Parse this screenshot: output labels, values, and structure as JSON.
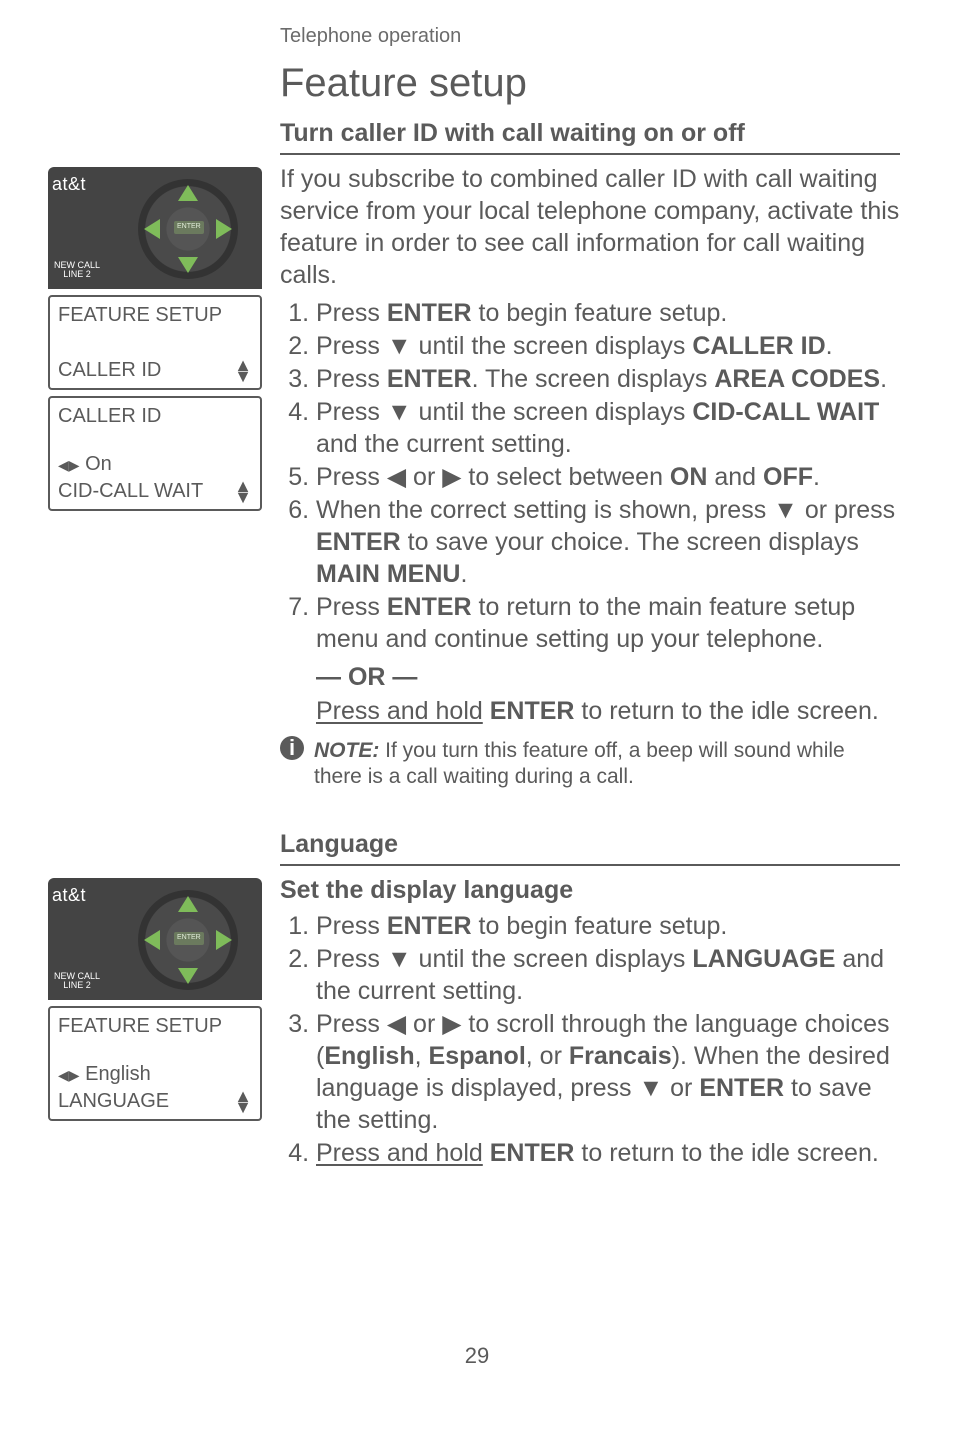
{
  "category": "Telephone operation",
  "title": "Feature setup",
  "page_number": "29",
  "device": {
    "logo": "at&t",
    "line_btn_top": "NEW CALL",
    "line_btn_bottom": "LINE 2",
    "center_btn": "ENTER"
  },
  "g": {
    "down": "▼",
    "up": "▲",
    "left": "◀",
    "right": "▶",
    "lr": "◀▶"
  },
  "sec1": {
    "heading": "Turn caller ID with call waiting on or off",
    "intro": "If you subscribe to combined caller ID with call waiting service from your local telephone company, activate this feature in order to see call information for call waiting calls.",
    "s1a": "Press ",
    "s1b": "ENTER",
    "s1c": " to begin feature setup.",
    "s2a": "Press ",
    "s2b": " until the screen displays ",
    "s2c": "CALLER ID",
    "s2d": ".",
    "s3a": "Press ",
    "s3b": "ENTER",
    "s3c": ". The screen displays ",
    "s3d": "AREA CODES",
    "s3e": ".",
    "s4a": "Press ",
    "s4b": " until the screen displays ",
    "s4c": "CID-CALL WAIT",
    "s4d": " and the current setting.",
    "s5a": "Press ",
    "s5b": " or ",
    "s5c": " to select between ",
    "s5d": "ON",
    "s5e": " and ",
    "s5f": "OFF",
    "s5g": ".",
    "s6a": "When the correct setting is shown, press ",
    "s6b": " or press ",
    "s6c": "ENTER",
    "s6d": " to save your choice. The screen displays ",
    "s6e": "MAIN MENU",
    "s6f": ".",
    "s7a": "Press ",
    "s7b": "ENTER",
    "s7c": " to return to the main feature setup menu and continue setting up your telephone.",
    "or": "— OR —",
    "s7d": "Press and hold",
    "s7e": " ",
    "s7f": "ENTER",
    "s7g": " to return to the idle screen.",
    "note_label": "NOTE:",
    "note_text": " If you turn this feature off, a beep will sound while there is a call waiting during a call.",
    "lcd1": {
      "l1": "FEATURE SETUP",
      "l4": "CALLER ID"
    },
    "lcd2": {
      "l1": "CALLER ID",
      "l3": "On",
      "l4": "CID-CALL WAIT"
    }
  },
  "sec2": {
    "heading": "Language",
    "subheading": "Set the display language",
    "s1a": "Press ",
    "s1b": "ENTER",
    "s1c": " to begin feature setup.",
    "s2a": "Press ",
    "s2b": " until the screen displays ",
    "s2c": "LANGUAGE",
    "s2d": " and the current setting.",
    "s3a": "Press ",
    "s3b": " or ",
    "s3c": " to scroll through the language choices (",
    "s3d": "English",
    "s3e": ", ",
    "s3f": "Espanol",
    "s3g": ", or ",
    "s3h": "Francais",
    "s3i": "). When the desired language is displayed, press ",
    "s3j": " or ",
    "s3k": "ENTER",
    "s3l": " to save the setting.",
    "s4a": "Press and hold",
    "s4b": " ",
    "s4c": "ENTER",
    "s4d": " to return to the idle screen.",
    "lcd": {
      "l1": "FEATURE SETUP",
      "l3": "English",
      "l4": "LANGUAGE"
    }
  }
}
